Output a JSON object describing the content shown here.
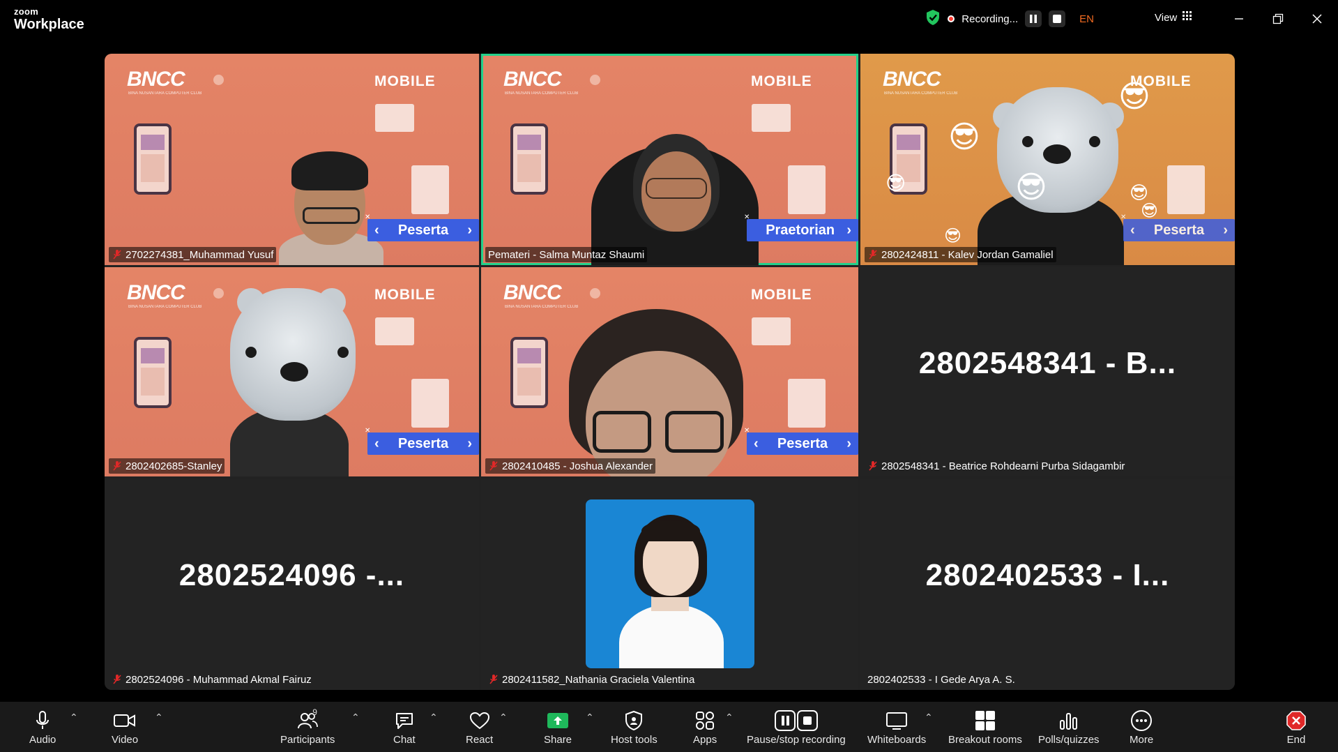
{
  "app": {
    "logo_top": "zoom",
    "logo_bottom": "Workplace"
  },
  "header": {
    "recording_label": "Recording...",
    "language": "EN",
    "view_label": "View"
  },
  "colors": {
    "active_speaker": "#23d18b",
    "language_accent": "#f26b21",
    "tag_blue": "#3b5ee0",
    "end_red": "#e02828"
  },
  "background": {
    "brand": "BNCC",
    "brand_sub": "BINA NUSANTARA COMPUTER CLUB",
    "track": "MOBILE"
  },
  "tiles": [
    {
      "name": "2702274381_Muhammad Yusuf",
      "tag": "Peserta",
      "muted": true
    },
    {
      "name": "Pemateri - Salma Muntaz Shaumi",
      "tag": "Praetorian",
      "muted": false,
      "active": true
    },
    {
      "name": "2802424811 - Kalev Jordan Gamaliel",
      "tag": "Peserta",
      "muted": true
    },
    {
      "name": "2802402685-Stanley",
      "tag": "Peserta",
      "muted": true
    },
    {
      "name": "2802410485 - Joshua Alexander",
      "tag": "Peserta",
      "muted": true
    },
    {
      "name": "2802548341 - Beatrice Rohdearni Purba Sidagambir",
      "display": "2802548341 - B...",
      "muted": true
    },
    {
      "name": "2802524096 - Muhammad Akmal Fairuz",
      "display": "2802524096 -...",
      "muted": true
    },
    {
      "name": "2802411582_Nathania Graciela Valentina",
      "muted": true
    },
    {
      "name": "2802402533 - I Gede Arya A. S.",
      "display": "2802402533 - I...",
      "muted": false
    }
  ],
  "toolbar": {
    "audio": "Audio",
    "video": "Video",
    "participants": "Participants",
    "participants_count": "9",
    "chat": "Chat",
    "react": "React",
    "share": "Share",
    "host_tools": "Host tools",
    "apps": "Apps",
    "pause_stop": "Pause/stop recording",
    "whiteboards": "Whiteboards",
    "breakout": "Breakout rooms",
    "polls": "Polls/quizzes",
    "more": "More",
    "end": "End"
  }
}
